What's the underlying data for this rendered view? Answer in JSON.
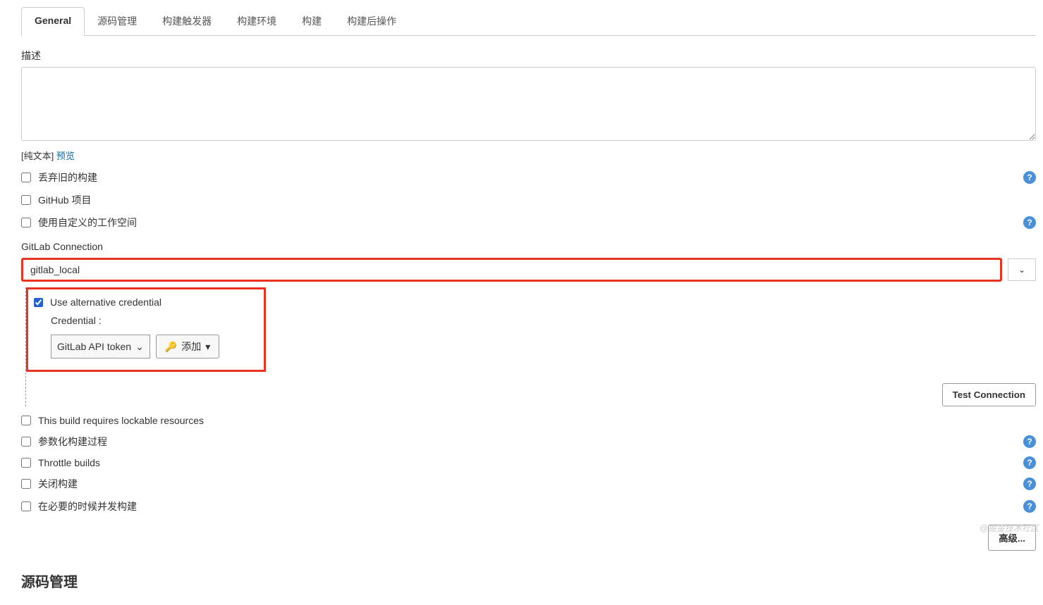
{
  "tabs": [
    {
      "label": "General",
      "active": true
    },
    {
      "label": "源码管理",
      "active": false
    },
    {
      "label": "构建触发器",
      "active": false
    },
    {
      "label": "构建环境",
      "active": false
    },
    {
      "label": "构建",
      "active": false
    },
    {
      "label": "构建后操作",
      "active": false
    }
  ],
  "description": {
    "label": "描述",
    "value": "",
    "plain_text_label": "[纯文本]",
    "preview_label": "预览"
  },
  "checkboxes": {
    "discard_old": {
      "label": "丢弃旧的构建",
      "checked": false,
      "help": true
    },
    "github_project": {
      "label": "GitHub 项目",
      "checked": false,
      "help": false
    },
    "custom_workspace": {
      "label": "使用自定义的工作空间",
      "checked": false,
      "help": true
    }
  },
  "gitlab": {
    "label": "GitLab Connection",
    "value": "gitlab_local",
    "alt_credential": {
      "label": "Use alternative credential",
      "checked": true,
      "credential_label": "Credential :",
      "select_value": "GitLab API token",
      "add_button": "添加"
    },
    "test_button": "Test Connection"
  },
  "checkboxes2": {
    "lockable": {
      "label": "This build requires lockable resources",
      "checked": false,
      "help": false
    },
    "parameterized": {
      "label": "参数化构建过程",
      "checked": false,
      "help": true
    },
    "throttle": {
      "label": "Throttle builds",
      "checked": false,
      "help": true
    },
    "disable": {
      "label": "关闭构建",
      "checked": false,
      "help": true
    },
    "concurrent": {
      "label": "在必要的时候并发构建",
      "checked": false,
      "help": true
    }
  },
  "advanced_button": "高级...",
  "section_scm": "源码管理",
  "watermark": "@掘金技术社区"
}
